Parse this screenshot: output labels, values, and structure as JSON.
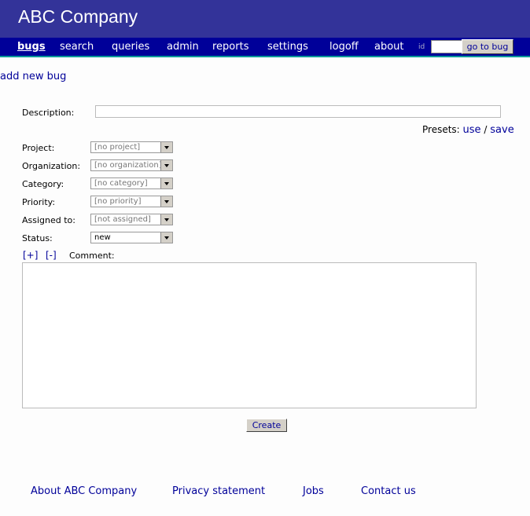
{
  "header": {
    "company": "ABC Company"
  },
  "nav": {
    "items": [
      "bugs",
      "search",
      "queries",
      "admin",
      "reports",
      "settings",
      "logoff",
      "about"
    ],
    "id_label": "id",
    "go_button": "go to bug"
  },
  "page": {
    "add_new_bug": "add new bug"
  },
  "form": {
    "description_label": "Description:",
    "presets_label": "Presets:",
    "presets_use": "use",
    "presets_sep": "/",
    "presets_save": "save",
    "fields": [
      {
        "label": "Project:",
        "value": "[no project]"
      },
      {
        "label": "Organization:",
        "value": "[no organization]"
      },
      {
        "label": "Category:",
        "value": "[no category]"
      },
      {
        "label": "Priority:",
        "value": "[no priority]"
      },
      {
        "label": "Assigned to:",
        "value": "[not assigned]"
      },
      {
        "label": "Status:",
        "value": "new"
      }
    ],
    "expand": "[+]",
    "collapse": "[-]",
    "comment_label": "Comment:",
    "create_button": "Create"
  },
  "footer": {
    "links": [
      "About ABC Company",
      "Privacy statement",
      "Jobs",
      "Contact us"
    ]
  },
  "colors": {
    "header_bg": "#333399",
    "nav_bg": "#000099",
    "link": "#000099"
  }
}
